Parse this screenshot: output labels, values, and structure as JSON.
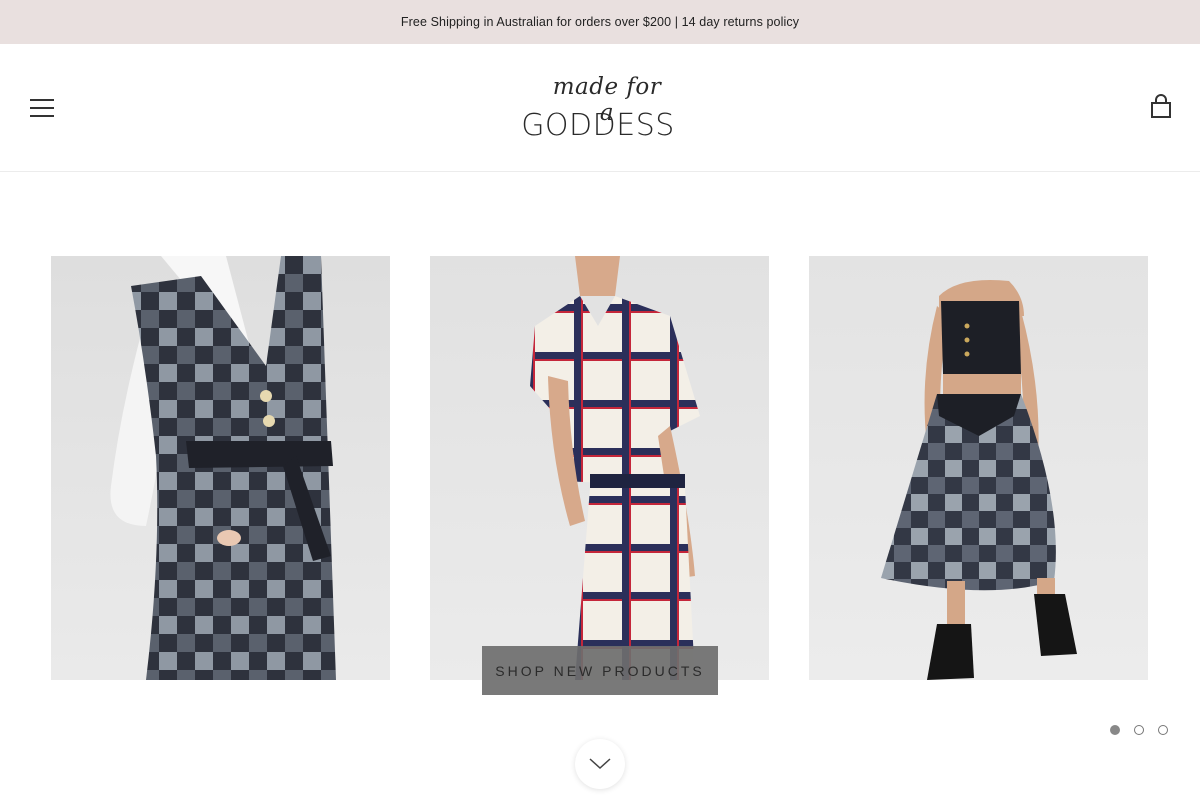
{
  "announcement": {
    "text": "Free Shipping in Australian for orders over $200 | 14 day returns policy"
  },
  "header": {
    "logo_script": "made for a",
    "logo_main": "GODDESS",
    "menu_icon": "hamburger-menu-icon",
    "cart_icon": "shopping-bag-icon"
  },
  "hero": {
    "cta_label": "SHOP NEW PRODUCTS",
    "products": [
      {
        "name": "Patchwork denim belted pinafore dress with white shirt"
      },
      {
        "name": "Red and blue grid print top and skirt set"
      },
      {
        "name": "Strapless crop top with patchwork denim midi skirt"
      }
    ],
    "slides": {
      "count": 3,
      "active_index": 0
    },
    "scroll_icon": "chevron-down-icon"
  },
  "colors": {
    "announcement_bg": "#e9e0df",
    "cta_bg": "#6e6e6e",
    "text": "#222222"
  }
}
